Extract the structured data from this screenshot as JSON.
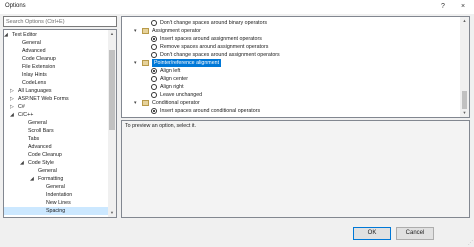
{
  "window": {
    "title": "Options",
    "help": "?",
    "close": "×"
  },
  "search": {
    "placeholder": "Search Options (Ctrl+E)"
  },
  "tree": {
    "items": [
      {
        "label": "Text Editor",
        "expander": "◢"
      },
      {
        "label": "General",
        "expander": ""
      },
      {
        "label": "Advanced",
        "expander": ""
      },
      {
        "label": "Code Cleanup",
        "expander": ""
      },
      {
        "label": "File Extension",
        "expander": ""
      },
      {
        "label": "Inlay Hints",
        "expander": ""
      },
      {
        "label": "CodeLens",
        "expander": ""
      },
      {
        "label": "All Languages",
        "expander": "▷"
      },
      {
        "label": "ASP.NET Web Forms",
        "expander": "▷"
      },
      {
        "label": "C#",
        "expander": "▷"
      },
      {
        "label": "C/C++",
        "expander": "◢"
      },
      {
        "label": "General",
        "expander": ""
      },
      {
        "label": "Scroll Bars",
        "expander": ""
      },
      {
        "label": "Tabs",
        "expander": ""
      },
      {
        "label": "Advanced",
        "expander": ""
      },
      {
        "label": "Code Cleanup",
        "expander": ""
      },
      {
        "label": "Code Style",
        "expander": "◢"
      },
      {
        "label": "General",
        "expander": ""
      },
      {
        "label": "Formatting",
        "expander": "◢"
      },
      {
        "label": "General",
        "expander": ""
      },
      {
        "label": "Indentation",
        "expander": ""
      },
      {
        "label": "New Lines",
        "expander": ""
      },
      {
        "label": "Spacing",
        "expander": ""
      }
    ]
  },
  "options": {
    "rows": [
      {
        "type": "radio",
        "label": "Don't change spaces around binary operators",
        "checked": false
      },
      {
        "type": "category",
        "label": "Assignment operator"
      },
      {
        "type": "radio",
        "label": "Insert spaces around assignment operators",
        "checked": true
      },
      {
        "type": "radio",
        "label": "Remove spaces around assignment operators",
        "checked": false
      },
      {
        "type": "radio",
        "label": "Don't change spaces around assignment operators",
        "checked": false
      },
      {
        "type": "category",
        "label": "Pointer/reference alignment",
        "highlight": true
      },
      {
        "type": "radio",
        "label": "Align left",
        "checked": true
      },
      {
        "type": "radio",
        "label": "Align center",
        "checked": false
      },
      {
        "type": "radio",
        "label": "Align right",
        "checked": false
      },
      {
        "type": "radio",
        "label": "Leave unchanged",
        "checked": false
      },
      {
        "type": "category",
        "label": "Conditional operator"
      },
      {
        "type": "radio",
        "label": "Insert spaces around conditional operators",
        "checked": true
      }
    ]
  },
  "preview": {
    "text": "To preview an option, select it."
  },
  "footer": {
    "ok": "OK",
    "cancel": "Cancel"
  }
}
